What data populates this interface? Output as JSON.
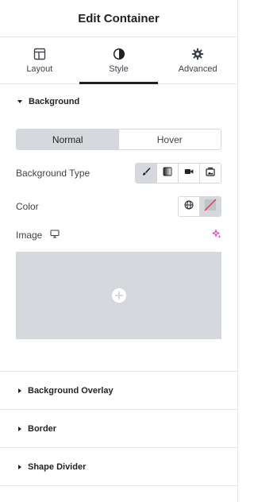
{
  "header": {
    "title": "Edit Container"
  },
  "tabs": [
    {
      "label": "Layout",
      "icon": "layout-icon"
    },
    {
      "label": "Style",
      "icon": "style-icon"
    },
    {
      "label": "Advanced",
      "icon": "gear-icon"
    }
  ],
  "active_tab": "Style",
  "background": {
    "title": "Background",
    "state_options": [
      "Normal",
      "Hover"
    ],
    "selected_state": "Normal",
    "type_label": "Background Type",
    "type_options": [
      "classic-brush-icon",
      "gradient-icon",
      "video-icon",
      "slideshow-icon"
    ],
    "selected_type": "classic-brush-icon",
    "color_label": "Color",
    "image_label": "Image"
  },
  "collapsed_sections": [
    {
      "title": "Background Overlay"
    },
    {
      "title": "Border"
    },
    {
      "title": "Shape Divider"
    }
  ],
  "colors": {
    "accent_ai": "#d63eb4",
    "active_bg": "#d5d8dc",
    "text": "#1f2124"
  }
}
